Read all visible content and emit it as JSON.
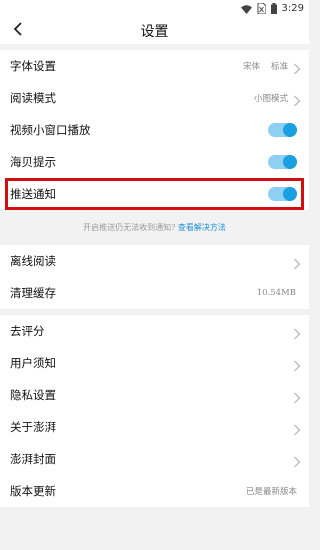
{
  "status_bar": {
    "time": "3:29",
    "icons": [
      "wifi-icon",
      "no-sim-icon",
      "battery-icon"
    ]
  },
  "header": {
    "title": "设置",
    "back_icon": "chevron-left-icon"
  },
  "group1": [
    {
      "label": "字体设置",
      "values": [
        "宋体",
        "标准"
      ],
      "control": "chevron"
    },
    {
      "label": "阅读模式",
      "value": "小图模式",
      "control": "chevron"
    },
    {
      "label": "视频小窗口播放",
      "control": "toggle",
      "on": true
    },
    {
      "label": "海贝提示",
      "control": "toggle",
      "on": true
    },
    {
      "label": "推送通知",
      "control": "toggle",
      "on": true
    }
  ],
  "hint": {
    "text": "开启推送仍无法收到通知?",
    "link": "查看解决方法"
  },
  "group2": [
    {
      "label": "离线阅读",
      "control": "chevron"
    },
    {
      "label": "清理缓存",
      "value": "10.54MB"
    }
  ],
  "group3": [
    {
      "label": "去评分",
      "control": "chevron"
    },
    {
      "label": "用户须知",
      "control": "chevron"
    },
    {
      "label": "隐私设置",
      "control": "chevron"
    },
    {
      "label": "关于澎湃",
      "control": "chevron"
    },
    {
      "label": "澎湃封面",
      "control": "chevron"
    },
    {
      "label": "版本更新",
      "value": "已是最新版本"
    }
  ],
  "colors": {
    "accent": "#1a9fe0",
    "toggle_track": "#8ed0f2",
    "highlight_border": "#d01010",
    "link": "#1a8fd8"
  }
}
